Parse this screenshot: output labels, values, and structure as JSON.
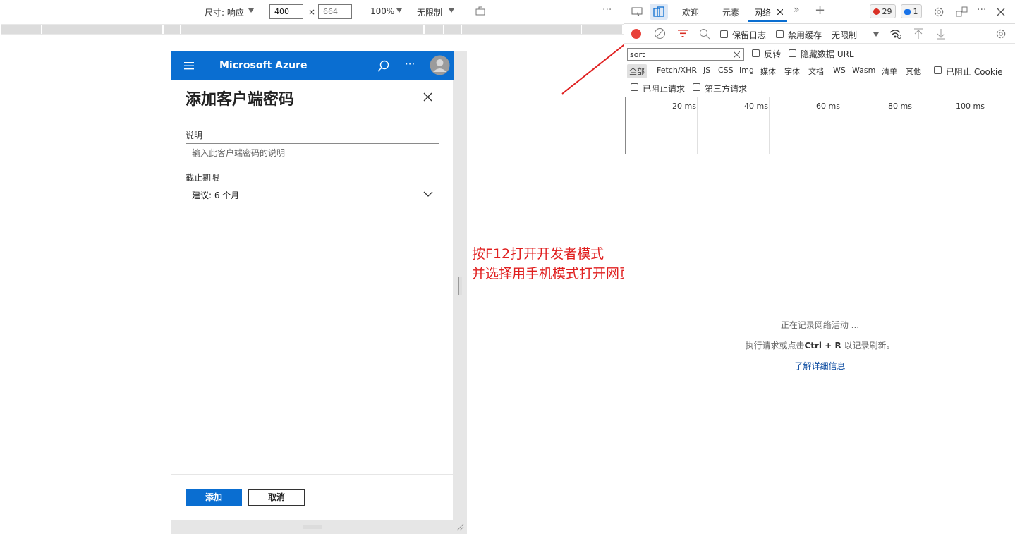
{
  "device_toolbar": {
    "dimensions_label": "尺寸: 响应",
    "width_value": "400",
    "times_symbol": "×",
    "height_value": "664",
    "zoom": "100%",
    "throttle": "无限制"
  },
  "azure": {
    "brand": "Microsoft Azure",
    "panel_title": "添加客户端密码",
    "description_label": "说明",
    "description_placeholder": "输入此客户端密码的说明",
    "expires_label": "截止期限",
    "expires_value": "建议: 6 个月",
    "add_button": "添加",
    "cancel_button": "取消"
  },
  "annotation": {
    "line1": "按F12打开开发者模式",
    "line2": "并选择用手机模式打开网页",
    "color": "#e02020"
  },
  "devtools": {
    "tabs": {
      "welcome": "欢迎",
      "elements": "元素",
      "network": "网络"
    },
    "error_count": "29",
    "message_count": "1",
    "toolbar": {
      "preserve_log": "保留日志",
      "disable_cache": "禁用缓存",
      "throttle": "无限制"
    },
    "filter": {
      "value": "sort",
      "invert": "反转",
      "hide_data_urls": "隐藏数据 URL",
      "types": [
        "全部",
        "Fetch/XHR",
        "JS",
        "CSS",
        "Img",
        "媒体",
        "字体",
        "文档",
        "WS",
        "Wasm",
        "清单",
        "其他"
      ],
      "blocked_cookies": "已阻止 Cookie",
      "blocked_requests": "已阻止请求",
      "third_party": "第三方请求"
    },
    "timeline_ticks": [
      "20 ms",
      "40 ms",
      "60 ms",
      "80 ms",
      "100 ms"
    ],
    "empty_state": {
      "recording": "正在记录网络活动 ...",
      "hint_prefix": "执行请求或点击",
      "hint_keys": "Ctrl + R",
      "hint_suffix": " 以记录刷新。",
      "learn_more": "了解详细信息"
    },
    "accent_color": "#0a6ed1"
  }
}
